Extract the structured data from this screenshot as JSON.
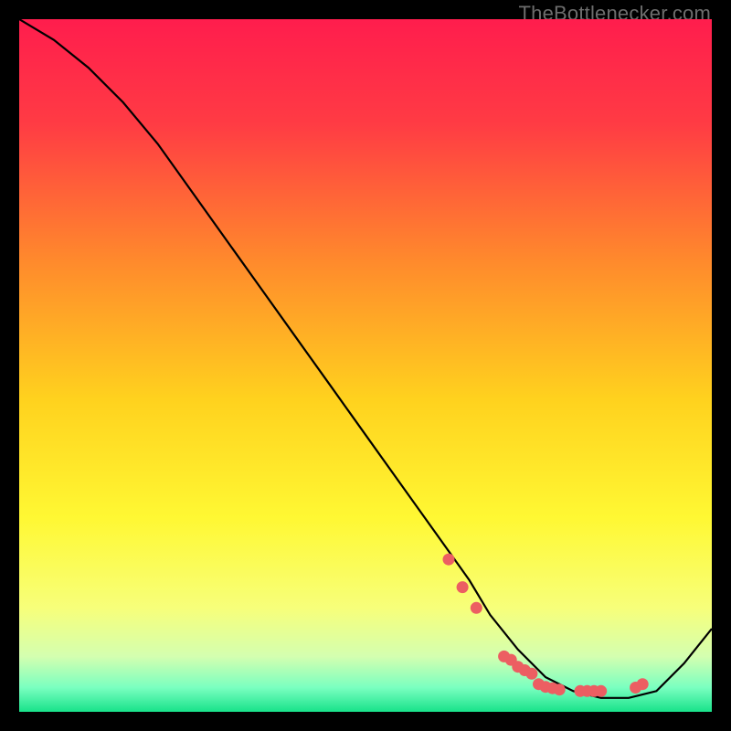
{
  "watermark": "TheBottlenecker.com",
  "chart_data": {
    "type": "line",
    "title": "",
    "xlabel": "",
    "ylabel": "",
    "xlim": [
      0,
      100
    ],
    "ylim": [
      0,
      100
    ],
    "series": [
      {
        "name": "curve",
        "x": [
          0,
          5,
          10,
          15,
          20,
          25,
          30,
          35,
          40,
          45,
          50,
          55,
          60,
          65,
          68,
          72,
          76,
          80,
          84,
          88,
          92,
          96,
          100
        ],
        "y": [
          100,
          97,
          93,
          88,
          82,
          75,
          68,
          61,
          54,
          47,
          40,
          33,
          26,
          19,
          14,
          9,
          5,
          3,
          2,
          2,
          3,
          7,
          12
        ]
      }
    ],
    "markers": {
      "name": "highlight-points",
      "x": [
        62,
        64,
        66,
        70,
        71,
        72,
        73,
        74,
        75,
        76,
        77,
        78,
        81,
        82,
        83,
        84,
        89,
        90
      ],
      "y": [
        22,
        18,
        15,
        8,
        7.5,
        6.5,
        6,
        5.5,
        4,
        3.6,
        3.4,
        3.2,
        3,
        3,
        3,
        3,
        3.5,
        4
      ]
    },
    "gradient_stops": [
      {
        "offset": 0.0,
        "color": "#ff1d4d"
      },
      {
        "offset": 0.15,
        "color": "#ff3b44"
      },
      {
        "offset": 0.35,
        "color": "#ff8a2c"
      },
      {
        "offset": 0.55,
        "color": "#ffd21e"
      },
      {
        "offset": 0.72,
        "color": "#fff833"
      },
      {
        "offset": 0.85,
        "color": "#f7ff7a"
      },
      {
        "offset": 0.92,
        "color": "#d4ffb0"
      },
      {
        "offset": 0.965,
        "color": "#7affc0"
      },
      {
        "offset": 1.0,
        "color": "#18e28a"
      }
    ]
  }
}
